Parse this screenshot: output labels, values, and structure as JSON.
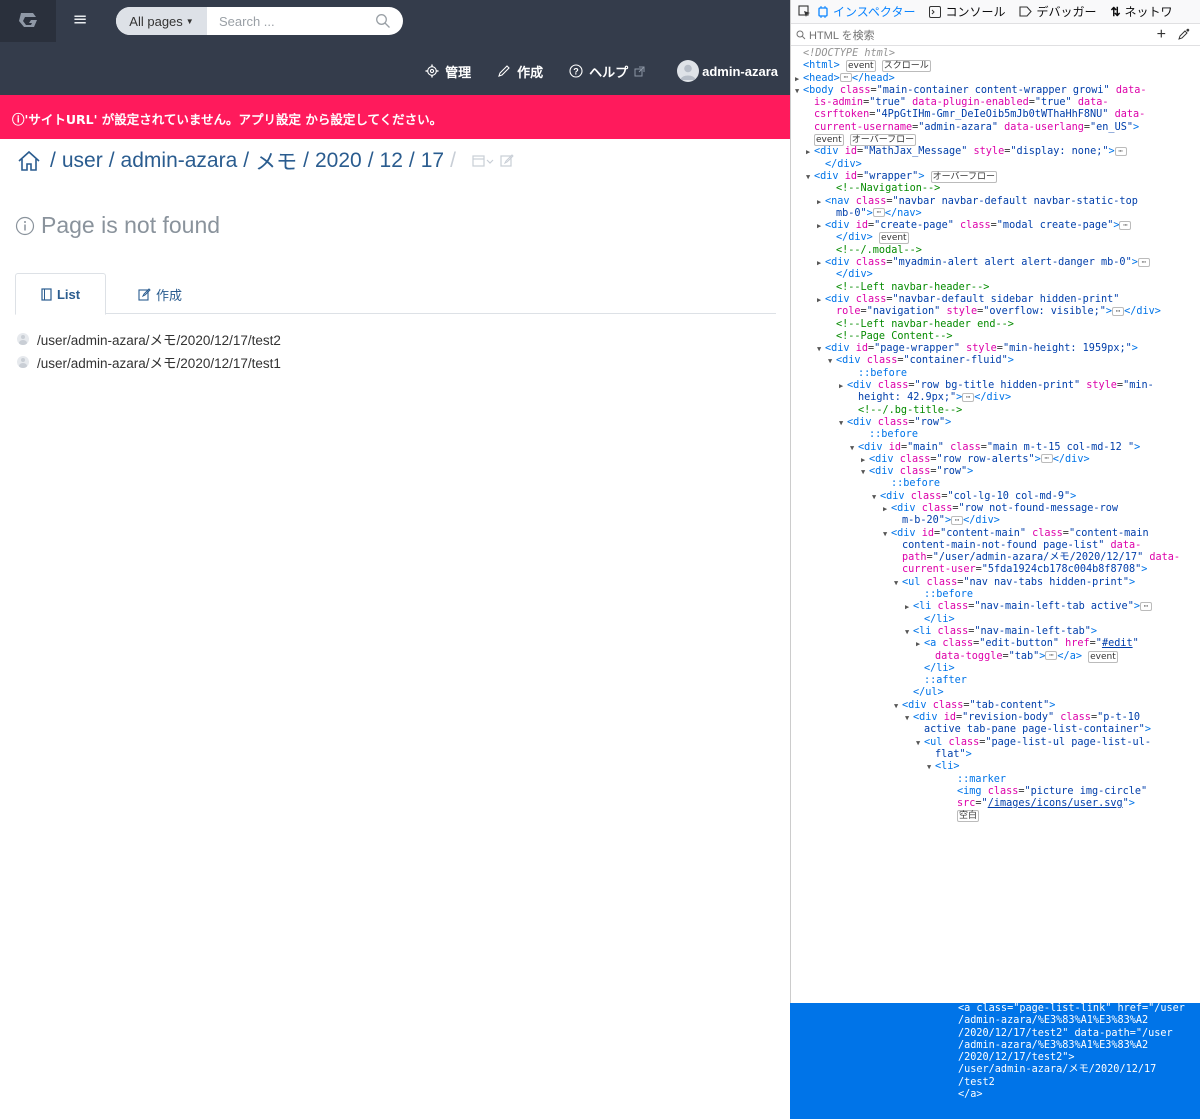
{
  "topbar": {
    "search_scope": "All pages",
    "search_placeholder": "Search ..."
  },
  "navbar": {
    "manage": "管理",
    "create": "作成",
    "help": "ヘルプ",
    "user": "admin-azara"
  },
  "alert": {
    "message": "'サイトURL' が設定されていません。アプリ設定 から設定してください。"
  },
  "breadcrumb": {
    "segments": [
      "user",
      "admin-azara",
      "メモ",
      "2020",
      "12",
      "17"
    ]
  },
  "not_found": {
    "title": "Page is not found"
  },
  "tabs": {
    "list": "List",
    "create": "作成"
  },
  "page_list": [
    "/user/admin-azara/メモ/2020/12/17/test2",
    "/user/admin-azara/メモ/2020/12/17/test1"
  ],
  "devtools": {
    "tabs": [
      "インスペクター",
      "コンソール",
      "デバッガー",
      "ネットワ"
    ],
    "search_placeholder": "HTML を検索",
    "lines": [
      {
        "indent": 0,
        "tw": "",
        "html": "<span class='dt'>&lt;!DOCTYPE html&gt;</span>"
      },
      {
        "indent": 0,
        "tw": "",
        "html": "<span class='tg'>&lt;html&gt;</span> <span class='bx'>event</span> <span class='bx'>スクロール</span>"
      },
      {
        "indent": 0,
        "tw": "▶",
        "html": "<span class='tg'>&lt;head&gt;</span><span class='el'>⋯</span><span class='tg'>&lt;/head&gt;</span>"
      },
      {
        "indent": 0,
        "tw": "▼",
        "html": "<span class='tg'>&lt;body</span> <span class='an'>class</span>=<span class='av'>\"main-container content-wrapper growi\"</span> <span class='an'>data-</span>"
      },
      {
        "indent": 1,
        "tw": "",
        "html": "<span class='an'>is-admin</span>=<span class='av'>\"true\"</span> <span class='an'>data-plugin-enabled</span>=<span class='av'>\"true\"</span> <span class='an'>data-</span>"
      },
      {
        "indent": 1,
        "tw": "",
        "html": "<span class='an'>csrftoken</span>=<span class='av'>\"4PpGtIHm-Gmr_DeIeOib5mJb0tWThaHhF8NU\"</span> <span class='an'>data-</span>"
      },
      {
        "indent": 1,
        "tw": "",
        "html": "<span class='an'>current-username</span>=<span class='av'>\"admin-azara\"</span> <span class='an'>data-userlang</span>=<span class='av'>\"en_US\"</span><span class='tg'>&gt;</span>"
      },
      {
        "indent": 1,
        "tw": "",
        "html": "<span class='bx'>event</span> <span class='bx'>オーバーフロー</span>"
      },
      {
        "indent": 1,
        "tw": "▶",
        "html": "<span class='tg'>&lt;div</span> <span class='an'>id</span>=<span class='av'>\"MathJax_Message\"</span> <span class='an'>style</span>=<span class='av'>\"display: none;\"</span><span class='tg'>&gt;</span><span class='el'>⋯</span>"
      },
      {
        "indent": 2,
        "tw": "",
        "html": "<span class='tg'>&lt;/div&gt;</span>"
      },
      {
        "indent": 1,
        "tw": "▼",
        "html": "<span class='tg'>&lt;div</span> <span class='an'>id</span>=<span class='av'>\"wrapper\"</span><span class='tg'>&gt;</span> <span class='bx'>オーバーフロー</span>"
      },
      {
        "indent": 3,
        "tw": "",
        "html": "<span class='cm'>&lt;!--Navigation--&gt;</span>"
      },
      {
        "indent": 2,
        "tw": "▶",
        "html": "<span class='tg'>&lt;nav</span> <span class='an'>class</span>=<span class='av'>\"navbar navbar-default navbar-static-top</span>"
      },
      {
        "indent": 3,
        "tw": "",
        "html": "<span class='av'>mb-0\"</span><span class='tg'>&gt;</span><span class='el'>⋯</span><span class='tg'>&lt;/nav&gt;</span>"
      },
      {
        "indent": 2,
        "tw": "▶",
        "html": "<span class='tg'>&lt;div</span> <span class='an'>id</span>=<span class='av'>\"create-page\"</span> <span class='an'>class</span>=<span class='av'>\"modal create-page\"</span><span class='tg'>&gt;</span><span class='el'>⋯</span>"
      },
      {
        "indent": 3,
        "tw": "",
        "html": "<span class='tg'>&lt;/div&gt;</span> <span class='bx'>event</span>"
      },
      {
        "indent": 3,
        "tw": "",
        "html": "<span class='cm'>&lt;!--/.modal--&gt;</span>"
      },
      {
        "indent": 2,
        "tw": "▶",
        "html": "<span class='tg'>&lt;div</span> <span class='an'>class</span>=<span class='av'>\"myadmin-alert alert alert-danger mb-0\"</span><span class='tg'>&gt;</span><span class='el'>⋯</span>"
      },
      {
        "indent": 3,
        "tw": "",
        "html": "<span class='tg'>&lt;/div&gt;</span>"
      },
      {
        "indent": 3,
        "tw": "",
        "html": "<span class='cm'>&lt;!--Left navbar-header--&gt;</span>"
      },
      {
        "indent": 2,
        "tw": "▶",
        "html": "<span class='tg'>&lt;div</span> <span class='an'>class</span>=<span class='av'>\"navbar-default sidebar hidden-print\"</span>"
      },
      {
        "indent": 3,
        "tw": "",
        "html": "<span class='an'>role</span>=<span class='av'>\"navigation\"</span> <span class='an'>style</span>=<span class='av'>\"overflow: visible;\"</span><span class='tg'>&gt;</span><span class='el'>⋯</span><span class='tg'>&lt;/div&gt;</span>"
      },
      {
        "indent": 3,
        "tw": "",
        "html": "<span class='cm'>&lt;!--Left navbar-header end--&gt;</span>"
      },
      {
        "indent": 3,
        "tw": "",
        "html": "<span class='cm'>&lt;!--Page Content--&gt;</span>"
      },
      {
        "indent": 2,
        "tw": "▼",
        "html": "<span class='tg'>&lt;div</span> <span class='an'>id</span>=<span class='av'>\"page-wrapper\"</span> <span class='an'>style</span>=<span class='av'>\"min-height: 1959px;\"</span><span class='tg'>&gt;</span>"
      },
      {
        "indent": 3,
        "tw": "▼",
        "html": "<span class='tg'>&lt;div</span> <span class='an'>class</span>=<span class='av'>\"container-fluid\"</span><span class='tg'>&gt;</span>"
      },
      {
        "indent": 5,
        "tw": "",
        "html": "<span class='ps'>::before</span>"
      },
      {
        "indent": 4,
        "tw": "▶",
        "html": "<span class='tg'>&lt;div</span> <span class='an'>class</span>=<span class='av'>\"row bg-title hidden-print\"</span> <span class='an'>style</span>=<span class='av'>\"min-</span>"
      },
      {
        "indent": 5,
        "tw": "",
        "html": "<span class='av'>height: 42.9px;\"</span><span class='tg'>&gt;</span><span class='el'>⋯</span><span class='tg'>&lt;/div&gt;</span>"
      },
      {
        "indent": 5,
        "tw": "",
        "html": "<span class='cm'>&lt;!--/.bg-title--&gt;</span>"
      },
      {
        "indent": 4,
        "tw": "▼",
        "html": "<span class='tg'>&lt;div</span> <span class='an'>class</span>=<span class='av'>\"row\"</span><span class='tg'>&gt;</span>"
      },
      {
        "indent": 6,
        "tw": "",
        "html": "<span class='ps'>::before</span>"
      },
      {
        "indent": 5,
        "tw": "▼",
        "html": "<span class='tg'>&lt;div</span> <span class='an'>id</span>=<span class='av'>\"main\"</span> <span class='an'>class</span>=<span class='av'>\"main m-t-15 col-md-12 \"</span><span class='tg'>&gt;</span>"
      },
      {
        "indent": 6,
        "tw": "▶",
        "html": "<span class='tg'>&lt;div</span> <span class='an'>class</span>=<span class='av'>\"row row-alerts\"</span><span class='tg'>&gt;</span><span class='el'>⋯</span><span class='tg'>&lt;/div&gt;</span>"
      },
      {
        "indent": 6,
        "tw": "▼",
        "html": "<span class='tg'>&lt;div</span> <span class='an'>class</span>=<span class='av'>\"row\"</span><span class='tg'>&gt;</span>"
      },
      {
        "indent": 8,
        "tw": "",
        "html": "<span class='ps'>::before</span>"
      },
      {
        "indent": 7,
        "tw": "▼",
        "html": "<span class='tg'>&lt;div</span> <span class='an'>class</span>=<span class='av'>\"col-lg-10 col-md-9\"</span><span class='tg'>&gt;</span>"
      },
      {
        "indent": 8,
        "tw": "▶",
        "html": "<span class='tg'>&lt;div</span> <span class='an'>class</span>=<span class='av'>\"row not-found-message-row</span>"
      },
      {
        "indent": 9,
        "tw": "",
        "html": "<span class='av'>m-b-20\"</span><span class='tg'>&gt;</span><span class='el'>⋯</span><span class='tg'>&lt;/div&gt;</span>"
      },
      {
        "indent": 8,
        "tw": "▼",
        "html": "<span class='tg'>&lt;div</span> <span class='an'>id</span>=<span class='av'>\"content-main\"</span> <span class='an'>class</span>=<span class='av'>\"content-main</span>"
      },
      {
        "indent": 9,
        "tw": "",
        "html": "<span class='av'>content-main-not-found page-list\"</span> <span class='an'>data-</span>"
      },
      {
        "indent": 9,
        "tw": "",
        "html": "<span class='an'>path</span>=<span class='av'>\"/user/admin-azara/メモ/2020/12/17\"</span> <span class='an'>data-</span>"
      },
      {
        "indent": 9,
        "tw": "",
        "html": "<span class='an'>current-user</span>=<span class='av'>\"5fda1924cb178c004b8f8708\"</span><span class='tg'>&gt;</span>"
      },
      {
        "indent": 9,
        "tw": "▼",
        "html": "<span class='tg'>&lt;ul</span> <span class='an'>class</span>=<span class='av'>\"nav nav-tabs hidden-print\"</span><span class='tg'>&gt;</span>"
      },
      {
        "indent": 11,
        "tw": "",
        "html": "<span class='ps'>::before</span>"
      },
      {
        "indent": 10,
        "tw": "▶",
        "html": "<span class='tg'>&lt;li</span> <span class='an'>class</span>=<span class='av'>\"nav-main-left-tab active\"</span><span class='tg'>&gt;</span><span class='el'>⋯</span>"
      },
      {
        "indent": 11,
        "tw": "",
        "html": "<span class='tg'>&lt;/li&gt;</span>"
      },
      {
        "indent": 10,
        "tw": "▼",
        "html": "<span class='tg'>&lt;li</span> <span class='an'>class</span>=<span class='av'>\"nav-main-left-tab\"</span><span class='tg'>&gt;</span>"
      },
      {
        "indent": 11,
        "tw": "▶",
        "html": "<span class='tg'>&lt;a</span> <span class='an'>class</span>=<span class='av'>\"edit-button\"</span> <span class='an'>href</span>=<span class='av'>\"</span><span class='lk'>#edit</span><span class='av'>\"</span>"
      },
      {
        "indent": 12,
        "tw": "",
        "html": "<span class='an'>data-toggle</span>=<span class='av'>\"tab\"</span><span class='tg'>&gt;</span><span class='el'>⋯</span><span class='tg'>&lt;/a&gt;</span> <span class='bx'>event</span>"
      },
      {
        "indent": 11,
        "tw": "",
        "html": "<span class='tg'>&lt;/li&gt;</span>"
      },
      {
        "indent": 11,
        "tw": "",
        "html": "<span class='ps'>::after</span>"
      },
      {
        "indent": 10,
        "tw": "",
        "html": "<span class='tg'>&lt;/ul&gt;</span>"
      },
      {
        "indent": 9,
        "tw": "▼",
        "html": "<span class='tg'>&lt;div</span> <span class='an'>class</span>=<span class='av'>\"tab-content\"</span><span class='tg'>&gt;</span>"
      },
      {
        "indent": 10,
        "tw": "▼",
        "html": "<span class='tg'>&lt;div</span> <span class='an'>id</span>=<span class='av'>\"revision-body\"</span> <span class='an'>class</span>=<span class='av'>\"p-t-10</span>"
      },
      {
        "indent": 11,
        "tw": "",
        "html": "<span class='av'>active tab-pane page-list-container\"</span><span class='tg'>&gt;</span>"
      },
      {
        "indent": 11,
        "tw": "▼",
        "html": "<span class='tg'>&lt;ul</span> <span class='an'>class</span>=<span class='av'>\"page-list-ul page-list-ul-</span>"
      },
      {
        "indent": 12,
        "tw": "",
        "html": "<span class='av'>flat\"</span><span class='tg'>&gt;</span>"
      },
      {
        "indent": 12,
        "tw": "▼",
        "html": "<span class='tg'>&lt;li&gt;</span>"
      },
      {
        "indent": 14,
        "tw": "",
        "html": "<span class='ps'>::marker</span>"
      },
      {
        "indent": 14,
        "tw": "",
        "html": "<span class='tg'>&lt;img</span> <span class='an'>class</span>=<span class='av'>\"picture img-circle\"</span>"
      },
      {
        "indent": 14,
        "tw": "",
        "html": "<span class='an'>src</span>=<span class='av'>\"</span><span class='lk'>/images/icons/user.svg</span><span class='av'>\"</span><span class='tg'>&gt;</span>"
      },
      {
        "indent": 14,
        "tw": "",
        "html": "<span class='bx'>空白</span>"
      }
    ],
    "selected_lines": [
      "<a class=\"page-list-link\" href=\"/user",
      "/admin-azara/%E3%83%A1%E3%83%A2",
      "/2020/12/17/test2\" data-path=\"/user",
      "/admin-azara/%E3%83%A1%E3%83%A2",
      "/2020/12/17/test2\">",
      "/user/admin-azara/メモ/2020/12/17",
      "/test2",
      "</a>"
    ]
  }
}
